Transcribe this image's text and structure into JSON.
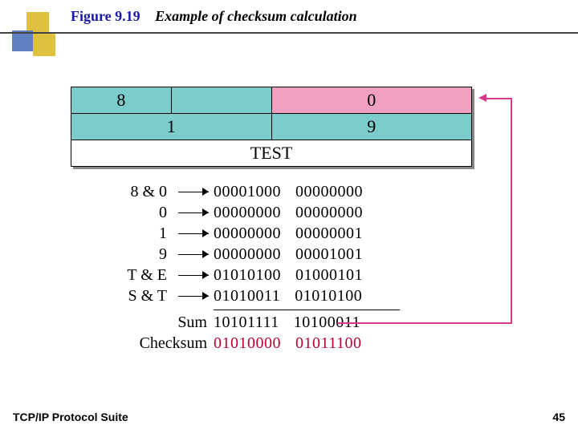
{
  "figure": {
    "number": "Figure 9.19",
    "caption": "Example of checksum calculation"
  },
  "table": {
    "r1c1": "8",
    "r1c2": "",
    "r1c3": "0",
    "r2c1": "1",
    "r2c2": "9",
    "r3": "TEST"
  },
  "calc": [
    {
      "label": "8 & 0",
      "b1": "00001000",
      "b2": "00000000"
    },
    {
      "label": "0",
      "b1": "00000000",
      "b2": "00000000"
    },
    {
      "label": "1",
      "b1": "00000000",
      "b2": "00000001"
    },
    {
      "label": "9",
      "b1": "00000000",
      "b2": "00001001"
    },
    {
      "label": "T & E",
      "b1": "01010100",
      "b2": "01000101"
    },
    {
      "label": "S & T",
      "b1": "01010011",
      "b2": "01010100"
    }
  ],
  "sum": {
    "label": "Sum",
    "b1": "10101111",
    "b2": "10100011"
  },
  "checksum": {
    "label": "Checksum",
    "b1": "01010000",
    "b2": "01011100"
  },
  "footer": {
    "left": "TCP/IP Protocol Suite",
    "right": "45"
  }
}
